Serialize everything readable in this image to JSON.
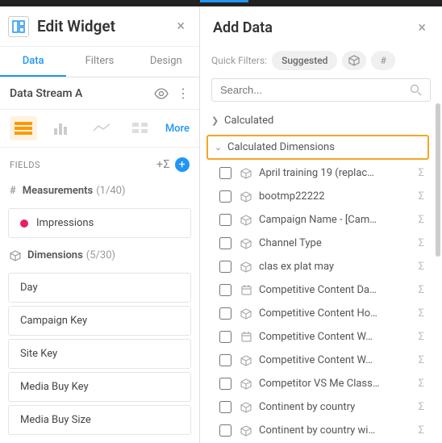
{
  "left": {
    "title": "Edit Widget",
    "tabs": {
      "data": "Data",
      "filters": "Filters",
      "design": "Design"
    },
    "stream": "Data Stream A",
    "more": "More",
    "fields_label": "FIELDS",
    "measurements": {
      "label": "Measurements",
      "count": "(1/40)",
      "items": [
        "Impressions"
      ]
    },
    "dimensions": {
      "label": "Dimensions",
      "count": "(5/30)",
      "items": [
        "Day",
        "Campaign Key",
        "Site Key",
        "Media Buy Key",
        "Media Buy Size"
      ]
    }
  },
  "right": {
    "title": "Add Data",
    "qf_label": "Quick Filters:",
    "suggested": "Suggested",
    "search_placeholder": "Search...",
    "groups": {
      "calculated": "Calculated",
      "calc_dims": "Calculated Dimensions"
    },
    "items": [
      {
        "label": "April training 19 (replac…",
        "icon": "cube"
      },
      {
        "label": "bootmp22222",
        "icon": "cube"
      },
      {
        "label": "Campaign Name - [Cam…",
        "icon": "cube"
      },
      {
        "label": "Channel Type",
        "icon": "cube"
      },
      {
        "label": "clas ex plat may",
        "icon": "cube"
      },
      {
        "label": "Competitive Content Da…",
        "icon": "cal"
      },
      {
        "label": "Competitive Content Ho…",
        "icon": "cube"
      },
      {
        "label": "Competitive Content W…",
        "icon": "cal"
      },
      {
        "label": "Competitive Content W…",
        "icon": "cube"
      },
      {
        "label": "Competitor VS Me Class…",
        "icon": "cube"
      },
      {
        "label": "Continent by country",
        "icon": "cube"
      },
      {
        "label": "Continent by country wi…",
        "icon": "cube"
      }
    ]
  }
}
